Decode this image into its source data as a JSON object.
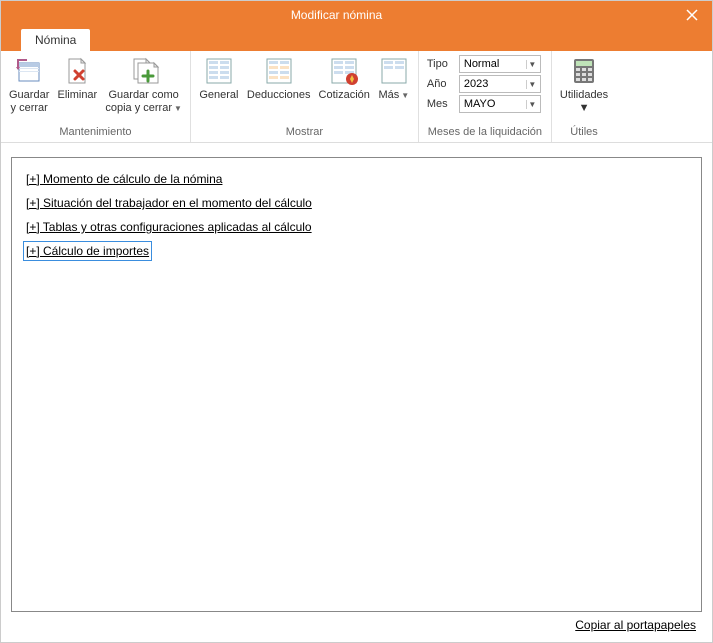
{
  "window": {
    "title": "Modificar nómina"
  },
  "tabs": {
    "active": "Nómina"
  },
  "ribbon": {
    "groups": {
      "maintenance": {
        "label": "Mantenimiento",
        "save_close": "Guardar\ny cerrar",
        "delete": "Eliminar",
        "save_copy": "Guardar como\ncopia y cerrar"
      },
      "show": {
        "label": "Mostrar",
        "general": "General",
        "deductions": "Deducciones",
        "contribution": "Cotización",
        "more": "Más"
      },
      "months": {
        "label": "Meses de la liquidación",
        "type_label": "Tipo",
        "type_value": "Normal",
        "year_label": "Año",
        "year_value": "2023",
        "month_label": "Mes",
        "month_value": "MAYO"
      },
      "tools": {
        "label": "Útiles",
        "utilities": "Utilidades"
      }
    }
  },
  "tree": {
    "items": [
      "[+] Momento de cálculo de la nómina",
      "[+] Situación del trabajador en el momento del cálculo",
      "[+] Tablas y otras configuraciones aplicadas al cálculo",
      "[+] Cálculo de importes"
    ],
    "active_index": 3
  },
  "footer": {
    "copy": "Copiar al portapapeles"
  }
}
